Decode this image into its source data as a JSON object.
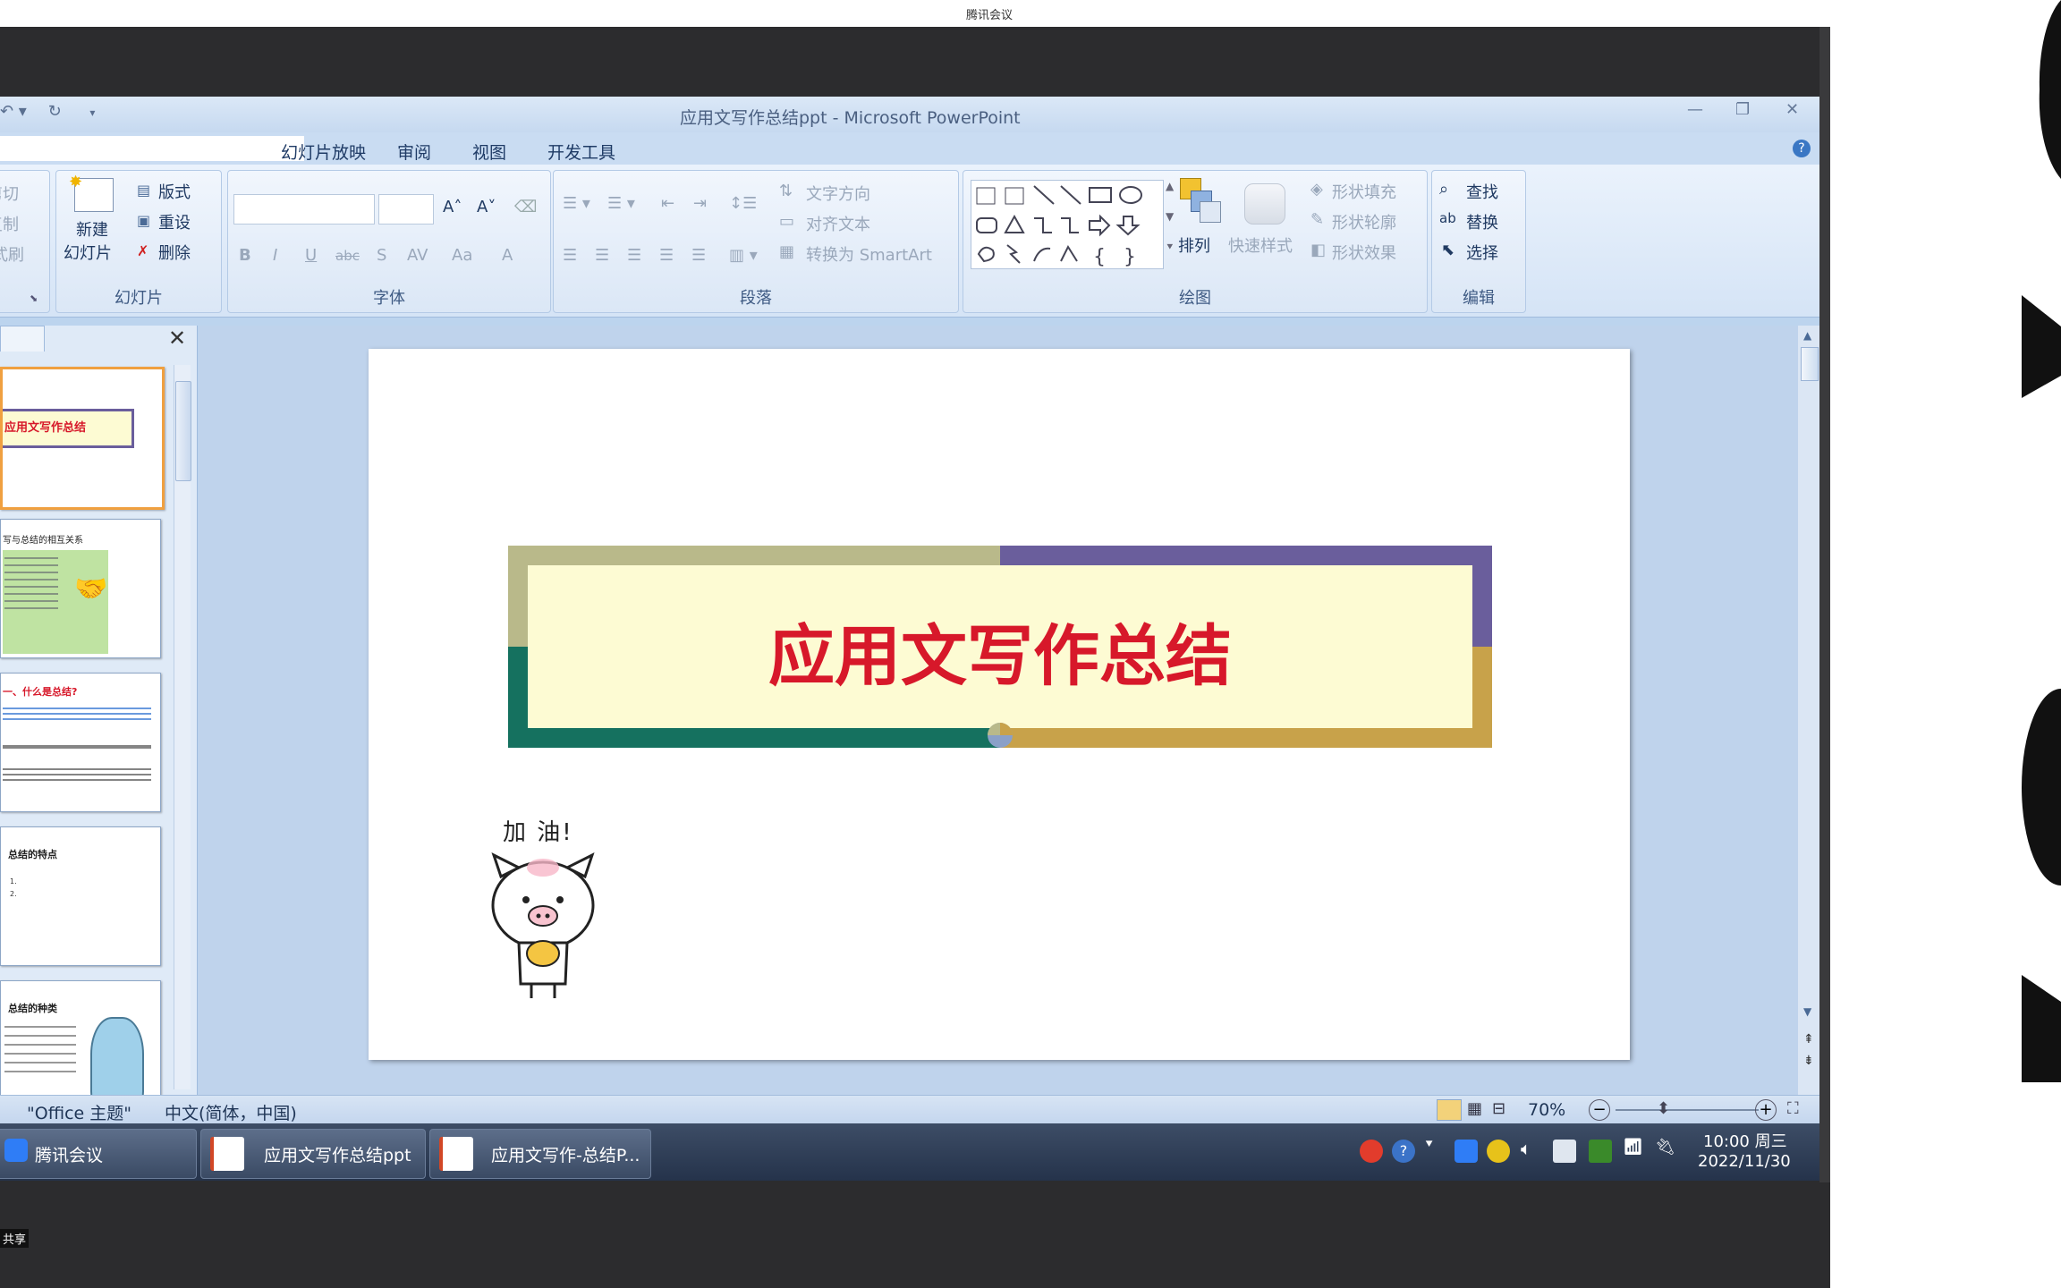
{
  "meeting": {
    "top_title": "腾讯会议",
    "share_label": "共享"
  },
  "window": {
    "title": "应用文写作总结ppt - Microsoft PowerPoint",
    "qat_icons": [
      "undo-icon",
      "redo-icon",
      "customize-icon"
    ]
  },
  "menu": {
    "tabs": [
      "幻灯片放映",
      "审阅",
      "视图",
      "开发工具"
    ]
  },
  "ribbon": {
    "clipboard": {
      "cut": "剪切",
      "copy": "复制",
      "format_painter": "格式刷"
    },
    "slides": {
      "new_slide_line1": "新建",
      "new_slide_line2": "幻灯片",
      "layout": "版式",
      "reset": "重设",
      "delete": "删除",
      "group_label": "幻灯片"
    },
    "font": {
      "group_label": "字体",
      "bold": "B",
      "italic": "I",
      "underline": "U",
      "strike": "abc",
      "shadow": "S",
      "spacing": "AV",
      "case": "Aa",
      "color": "A"
    },
    "paragraph": {
      "group_label": "段落",
      "text_direction": "文字方向",
      "align_text": "对齐文本",
      "smartart": "转换为 SmartArt"
    },
    "drawing": {
      "group_label": "绘图",
      "arrange": "排列",
      "quick_styles": "快速样式",
      "shape_fill": "形状填充",
      "shape_outline": "形状轮廓",
      "shape_effects": "形状效果"
    },
    "editing": {
      "group_label": "编辑",
      "find": "查找",
      "replace": "替换",
      "select": "选择"
    }
  },
  "thumbnails": [
    {
      "title": "应用文写作总结"
    },
    {
      "title": "写与总结的相互关系"
    },
    {
      "title": "一、什么是总结?"
    },
    {
      "title": "总结的特点",
      "items": [
        "1.",
        "2."
      ]
    },
    {
      "title": "总结的种类"
    }
  ],
  "slide": {
    "title": "应用文写作总结",
    "cheer_text": "加 油!"
  },
  "status": {
    "theme": "\"Office 主题\"",
    "language": "中文(简体，中国)",
    "zoom": "70%"
  },
  "taskbar": {
    "items": [
      {
        "label": "腾讯会议"
      },
      {
        "label": "应用文写作总结ppt"
      },
      {
        "label": "应用文写作-总结P..."
      }
    ],
    "time": "10:00 周三",
    "date": "2022/11/30"
  },
  "colors": {
    "slide_title": "#d7182a",
    "banner_fill": "#fdfbd3",
    "banner_olive": "#b9b98a",
    "banner_purple": "#6a5e9c",
    "banner_teal": "#15715f",
    "banner_gold": "#c8a24a"
  }
}
